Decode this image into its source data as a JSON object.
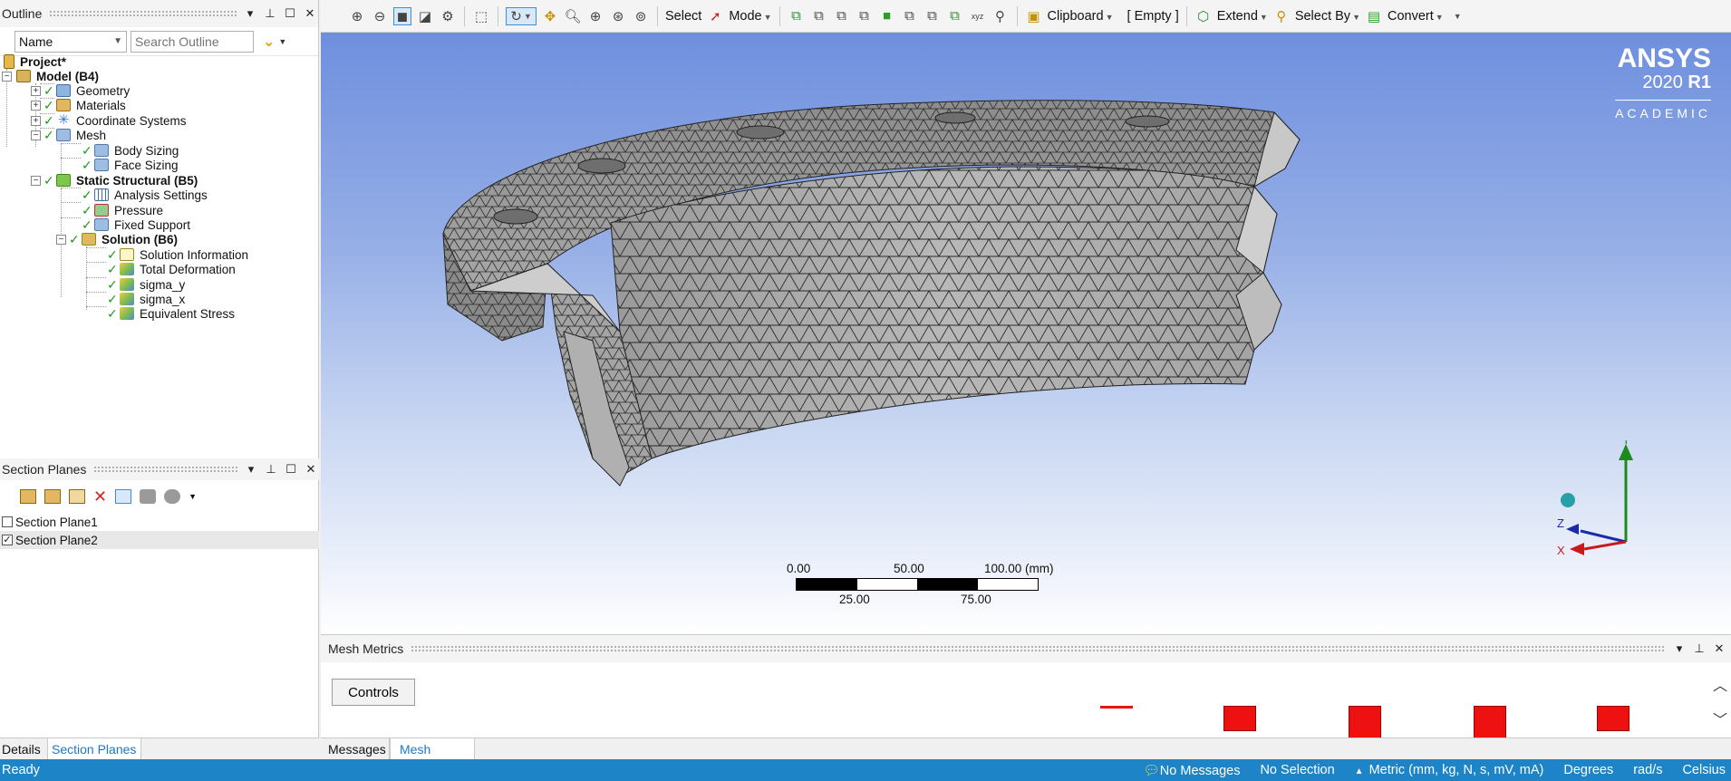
{
  "outline": {
    "title": "Outline",
    "filter_field": "Name",
    "search_placeholder": "Search Outline",
    "tree": {
      "project": "Project*",
      "model": "Model (B4)",
      "geometry": "Geometry",
      "materials": "Materials",
      "coordinate_systems": "Coordinate Systems",
      "mesh": "Mesh",
      "body_sizing": "Body Sizing",
      "face_sizing": "Face Sizing",
      "static_structural": "Static Structural (B5)",
      "analysis_settings": "Analysis Settings",
      "pressure": "Pressure",
      "fixed_support": "Fixed Support",
      "solution": "Solution (B6)",
      "solution_information": "Solution Information",
      "total_deformation": "Total Deformation",
      "sigma_y": "sigma_y",
      "sigma_x": "sigma_x",
      "equivalent_stress": "Equivalent Stress"
    }
  },
  "section_planes": {
    "title": "Section Planes",
    "items": [
      {
        "label": "Section Plane1",
        "checked": false
      },
      {
        "label": "Section Plane2",
        "checked": true
      }
    ]
  },
  "left_tabs": {
    "details": "Details",
    "section_planes": "Section Planes"
  },
  "toolbar": {
    "select": "Select",
    "mode": "Mode",
    "clipboard": "Clipboard",
    "clipboard_state": "[ Empty ]",
    "extend": "Extend",
    "select_by": "Select By",
    "convert": "Convert"
  },
  "branding": {
    "name": "ANSYS",
    "version": "2020",
    "release": "R1",
    "edition": "ACADEMIC"
  },
  "scale": {
    "t0": "0.00",
    "t50": "50.00",
    "t100": "100.00 (mm)",
    "t25": "25.00",
    "t75": "75.00"
  },
  "triad": {
    "y": "Y",
    "z": "Z",
    "x": "X"
  },
  "mesh_metrics": {
    "title": "Mesh Metrics",
    "controls": "Controls"
  },
  "bottom_tabs": {
    "messages": "Messages",
    "mesh_metrics": "Mesh Metrics"
  },
  "status": {
    "ready": "Ready",
    "messages": "No Messages",
    "selection": "No Selection",
    "units": "Metric (mm, kg, N, s, mV, mA)",
    "angle": "Degrees",
    "rate": "rad/s",
    "temp": "Celsius"
  },
  "colors": {
    "accent": "#1c84c7",
    "status_bar": "#1c84c7",
    "check": "#1a9a1a",
    "metric_bar": "#ee1111"
  }
}
